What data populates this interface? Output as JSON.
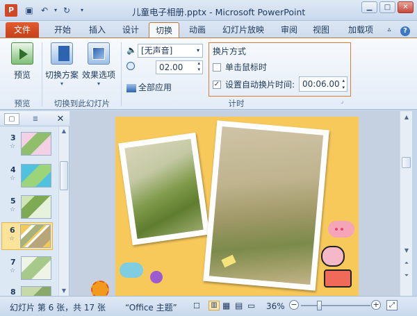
{
  "window": {
    "title": "儿童电子相册.pptx - Microsoft PowerPoint",
    "app_icon": "P"
  },
  "tabs": [
    {
      "label": "文件"
    },
    {
      "label": "开始"
    },
    {
      "label": "插入"
    },
    {
      "label": "设计"
    },
    {
      "label": "切换"
    },
    {
      "label": "动画"
    },
    {
      "label": "幻灯片放映"
    },
    {
      "label": "审阅"
    },
    {
      "label": "视图"
    },
    {
      "label": "加载项"
    }
  ],
  "active_tab": "切换",
  "ribbon": {
    "preview": {
      "label": "预览",
      "group": "预览"
    },
    "transition_scheme": {
      "label": "切换方案"
    },
    "effect_options": {
      "label": "效果选项"
    },
    "transition_group": "切换到此幻灯片",
    "sound": {
      "value": "[无声音]"
    },
    "duration": {
      "value": "02.00"
    },
    "apply_all": {
      "label": "全部应用"
    },
    "advance": {
      "title": "换片方式",
      "on_click": {
        "label": "单击鼠标时",
        "checked": false
      },
      "after": {
        "label": "设置自动换片时间:",
        "checked": true,
        "value": "00:06.00"
      }
    },
    "timing_group": "计时"
  },
  "slides": [
    {
      "num": "3",
      "star": "☆",
      "color": "#e9a8c8"
    },
    {
      "num": "4",
      "star": "☆",
      "color": "#4fc2e0"
    },
    {
      "num": "5",
      "star": "☆",
      "color": "#9cc96a"
    },
    {
      "num": "6",
      "star": "☆",
      "color": "#f2c95c",
      "selected": true
    },
    {
      "num": "7",
      "star": "☆",
      "color": "#d7e7c8"
    },
    {
      "num": "8",
      "star": "☆",
      "color": "#c6d9a8"
    }
  ],
  "status": {
    "slide_info": "幻灯片 第 6 张，共 17 张",
    "theme": "“Office 主题”",
    "zoom": "36%",
    "zoom_level": 0.36
  },
  "colors": {
    "accent": "#c2763c",
    "file_tab": "#d24726",
    "slide_bg": "#f7c85a"
  }
}
